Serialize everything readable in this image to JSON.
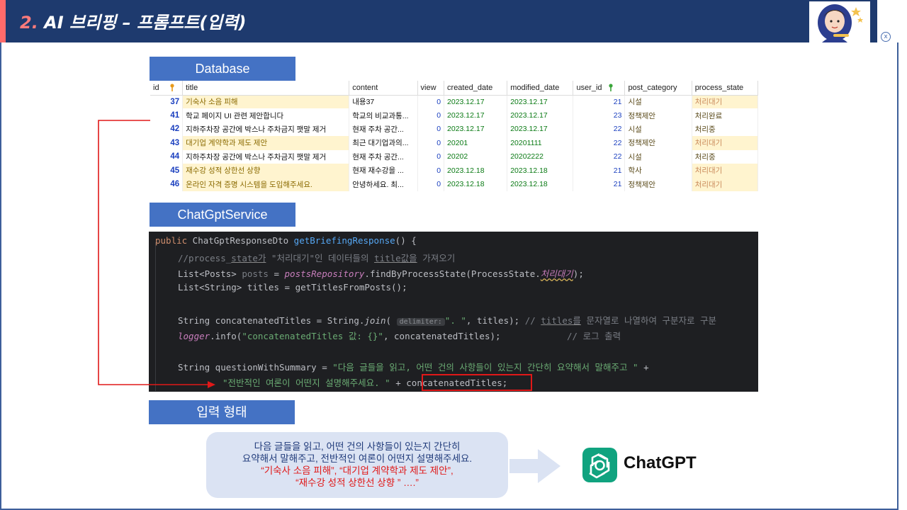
{
  "header": {
    "number": "2.",
    "title": " AI 브리핑 – 프롬프트(입력)",
    "close_label": "x"
  },
  "sections": {
    "database": "Database",
    "service": "ChatGptService",
    "input": "입력 형태"
  },
  "table": {
    "columns": [
      "id",
      "title",
      "content",
      "view",
      "created_date",
      "modified_date",
      "user_id",
      "post_category",
      "process_state"
    ],
    "rows": [
      {
        "id": "37",
        "title": "기숙사 소음 피해",
        "content": "내용37",
        "view": "0",
        "created": "2023.12.17",
        "modified": "2023.12.17",
        "user": "21",
        "category": "시설",
        "state": "처리대기"
      },
      {
        "id": "41",
        "title": "학교 페이지 UI 관련 제안합니다",
        "content": "학교의 비교과통...",
        "view": "0",
        "created": "2023.12.17",
        "modified": "2023.12.17",
        "user": "23",
        "category": "정책제안",
        "state": "처리완료"
      },
      {
        "id": "42",
        "title": "지하주차장 공간에 박스나 주차금지 팻말 제거",
        "content": "현재 주차 공간...",
        "view": "0",
        "created": "2023.12.17",
        "modified": "2023.12.17",
        "user": "22",
        "category": "시설",
        "state": "처리중"
      },
      {
        "id": "43",
        "title": "대기업 계약학과 제도 제안",
        "content": "최근 대기업과의...",
        "view": "0",
        "created": "20201",
        "modified": "20201111",
        "user": "22",
        "category": "정책제안",
        "state": "처리대기"
      },
      {
        "id": "44",
        "title": "지하주차장 공간에 박스나 주차금지 팻말 제거",
        "content": "현재 주차 공간...",
        "view": "0",
        "created": "20202",
        "modified": "20202222",
        "user": "22",
        "category": "시설",
        "state": "처리중"
      },
      {
        "id": "45",
        "title": "재수강 성적 상한선 상향",
        "content": "현재 재수강을 ...",
        "view": "0",
        "created": "2023.12.18",
        "modified": "2023.12.18",
        "user": "21",
        "category": "학사",
        "state": "처리대기"
      },
      {
        "id": "46",
        "title": "온라인 자격 증명 시스템을 도입해주세요.",
        "content": "안녕하세요. 최...",
        "view": "0",
        "created": "2023.12.18",
        "modified": "2023.12.18",
        "user": "21",
        "category": "정책제안",
        "state": "처리대기"
      }
    ],
    "highlighted_title_ids": [
      "37",
      "43",
      "45",
      "46"
    ]
  },
  "code": {
    "l1_kw": "public",
    "l1_type": " ChatGptResponseDto ",
    "l1_fn": "getBriefingResponse",
    "l1_end": "() {",
    "l2": "//process_",
    "l2_state": "state가",
    "l2_b": " \"처리대기\"인 데이터들의 ",
    "l2_title": "title값을",
    "l2_c": " 가져오기",
    "l3_a": "List<Posts> ",
    "l3_posts": "posts",
    "l3_b": " = ",
    "l3_repo": "postsRepository",
    "l3_c": ".findByProcessState(ProcessState.",
    "l3_enum": "처리대기",
    "l3_d": ");",
    "l4": "List<String> titles = getTitlesFromPosts();",
    "l5_a": "String concatenatedTitles = String.",
    "l5_join": "join",
    "l5_b": "( ",
    "l5_hint": "delimiter:",
    "l5_str": "\". \"",
    "l5_c": ", titles); ",
    "l5_cm_a": "// ",
    "l5_cm_titles": "titles를",
    "l5_cm_b": " 문자열로 나열하여 구분자로 구분",
    "l6_logger": "logger",
    "l6_a": ".info(",
    "l6_str": "\"concatenatedTitles 값: {}\"",
    "l6_b": ", concatenatedTitles);",
    "l6_cm": "// 로그 출력",
    "l7_a": "String questionWithSummary = ",
    "l7_str": "\"다음 글들을 읽고, 어떤 건의 사항들이 있는지 간단히 요약해서 말해주고 \"",
    "l7_b": " +",
    "l8_str": "\"전반적인 여론이 어떤지 설명해주세요. \"",
    "l8_b": " + ",
    "l8_c": "concatenatedTitles;"
  },
  "bubble": {
    "line1": "다음 글들을 읽고, 어떤 건의 사항들이 있는지 간단히",
    "line2": "요약해서 말해주고, 전반적인 여론이 어떤지 설명해주세요.",
    "line3": "“기숙사 소음 피해”, “대기업 계약학과 제도 제안”,",
    "line4": "“재수강 성적 상한선 상향 ” ….”"
  },
  "chatgpt": {
    "name": "ChatGPT"
  },
  "colors": {
    "header": "#1e3a6e",
    "section": "#4472c4",
    "code_bg": "#1e1f22",
    "highlight": "#e01818"
  }
}
